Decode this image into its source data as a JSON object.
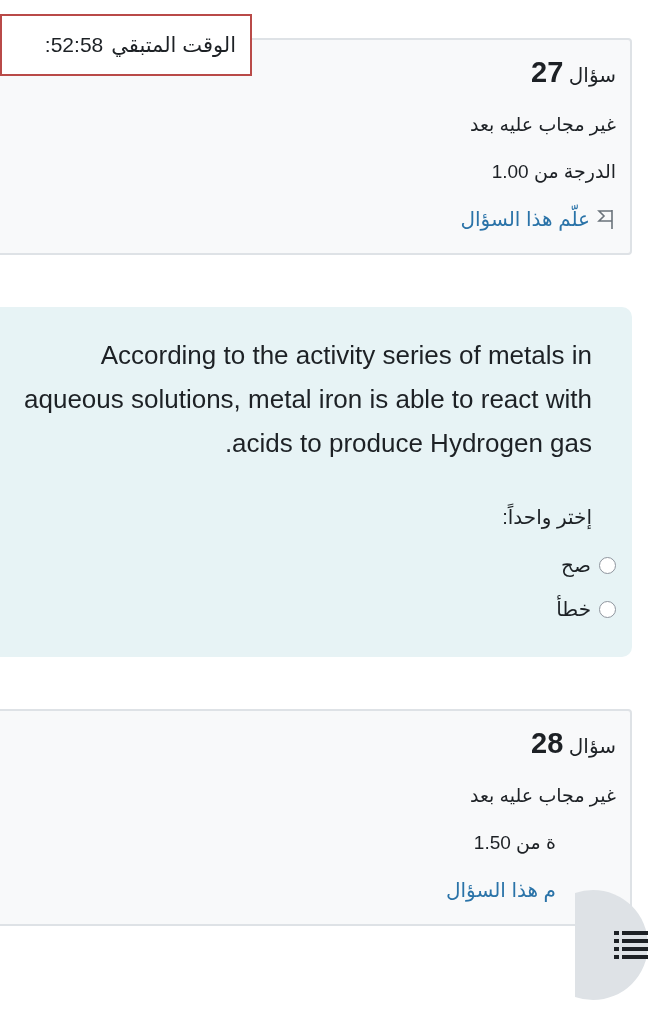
{
  "timer": {
    "label": "الوقت المتبقي",
    "value": ":52:58"
  },
  "blocks": [
    {
      "kind": "info",
      "title": "سؤال",
      "number": "27",
      "status": "غير مجاب عليه بعد",
      "grade": "الدرجة من 1.00",
      "flag": "علّم هذا السؤال"
    },
    {
      "kind": "content",
      "text": "According to the activity series of metals in aqueous solutions, metal iron is able to react with acids to produce Hydrogen gas.",
      "prompt": "إختر واحداً:",
      "options": [
        {
          "label": "صح",
          "selected": false
        },
        {
          "label": "خطأ",
          "selected": false
        }
      ]
    },
    {
      "kind": "info",
      "title": "سؤال",
      "number": "28",
      "status": "غير مجاب عليه بعد",
      "grade": "ة من 1.50",
      "flag": "م هذا السؤال"
    }
  ]
}
